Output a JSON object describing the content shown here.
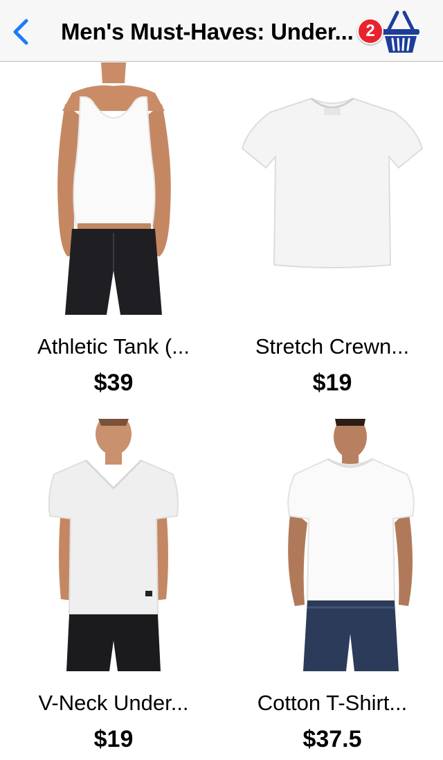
{
  "navbar": {
    "title": "Men's Must-Haves: Under...",
    "back_icon": "chevron-left-icon",
    "cart_icon": "basket-icon",
    "cart_count": "2",
    "accent_color": "#1a7cf9",
    "cart_color": "#1c3d9c",
    "badge_color": "#e8232e"
  },
  "products": [
    {
      "name": "Athletic Tank (...",
      "price": "$39"
    },
    {
      "name": "Stretch Crewn...",
      "price": "$19"
    },
    {
      "name": "V-Neck Under...",
      "price": "$19"
    },
    {
      "name": "Cotton T-Shirt...",
      "price": "$37.5"
    }
  ]
}
